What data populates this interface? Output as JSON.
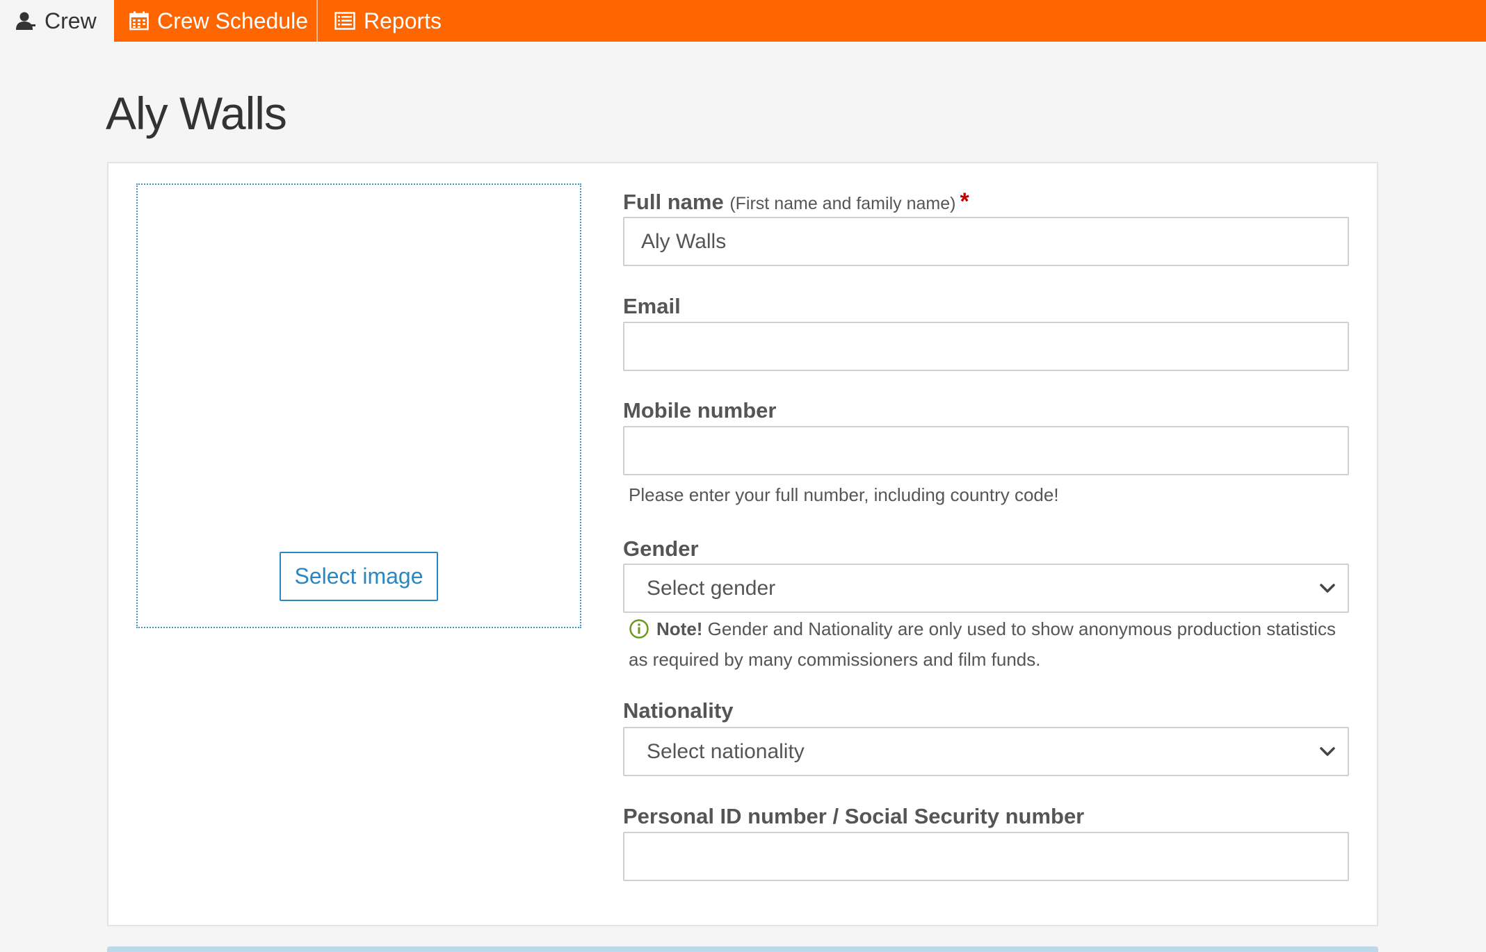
{
  "nav": {
    "tabs": [
      {
        "label": "Crew",
        "icon": "person-icon",
        "active": true
      },
      {
        "label": "Crew Schedule",
        "icon": "calendar-icon",
        "active": false
      },
      {
        "label": "Reports",
        "icon": "list-icon",
        "active": false
      }
    ],
    "accent_color": "#ff6600"
  },
  "page": {
    "title": "Aly Walls"
  },
  "image": {
    "select_label": "Select image"
  },
  "form": {
    "full_name": {
      "label": "Full name",
      "hint": "(First name and family name)",
      "required_mark": "*",
      "value": "Aly Walls"
    },
    "email": {
      "label": "Email",
      "value": ""
    },
    "mobile": {
      "label": "Mobile number",
      "value": "",
      "help": "Please enter your full number, including country code!"
    },
    "gender": {
      "label": "Gender",
      "selected": "Select gender",
      "note_strong": "Note!",
      "note_text": "Gender and Nationality are only used to show anonymous production statistics as required by many commissioners and film funds."
    },
    "nationality": {
      "label": "Nationality",
      "selected": "Select nationality"
    },
    "personal_id": {
      "label": "Personal ID number / Social Security number",
      "value": ""
    }
  }
}
